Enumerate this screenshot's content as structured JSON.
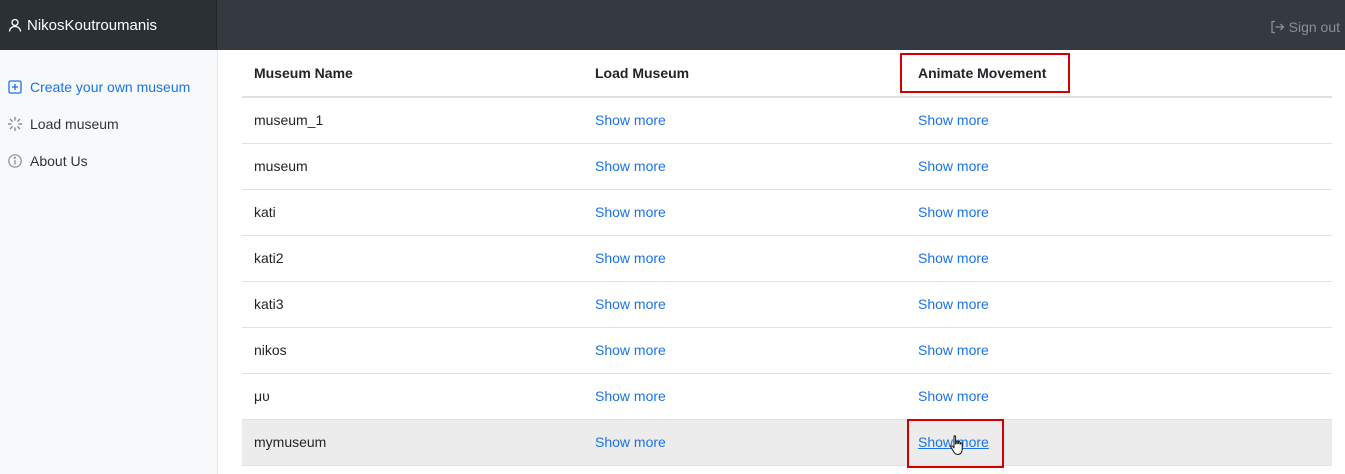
{
  "header": {
    "username": "NikosKoutroumanis",
    "signout_label": "Sign out"
  },
  "sidebar": {
    "items": [
      {
        "label": "Create your own museum",
        "icon": "plus-square-icon",
        "active": true
      },
      {
        "label": "Load museum",
        "icon": "loader-icon",
        "active": false
      },
      {
        "label": "About Us",
        "icon": "info-icon",
        "active": false
      }
    ]
  },
  "table": {
    "headers": [
      "Museum Name",
      "Load Museum",
      "Animate Movement"
    ],
    "rows": [
      {
        "name": "museum_1",
        "load": "Show more",
        "animate": "Show more"
      },
      {
        "name": "museum",
        "load": "Show more",
        "animate": "Show more"
      },
      {
        "name": "kati",
        "load": "Show more",
        "animate": "Show more"
      },
      {
        "name": "kati2",
        "load": "Show more",
        "animate": "Show more"
      },
      {
        "name": "kati3",
        "load": "Show more",
        "animate": "Show more"
      },
      {
        "name": "nikos",
        "load": "Show more",
        "animate": "Show more"
      },
      {
        "name": "μυ",
        "load": "Show more",
        "animate": "Show more"
      },
      {
        "name": "mymuseum",
        "load": "Show more",
        "animate": "Show more"
      }
    ]
  },
  "colors": {
    "topbar": "#343a40",
    "brand": "#2b3035",
    "link": "#1a73e8",
    "highlight": "#d40000",
    "hover_row": "#ececec"
  }
}
